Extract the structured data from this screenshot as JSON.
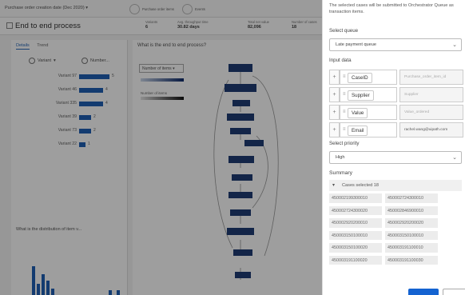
{
  "background": {
    "filter_label": "Purchase order creation date (Dec 2020)",
    "chip1": "Purchase order items",
    "chip2": "Events",
    "page_title": "End to end process",
    "kpis": [
      {
        "label": "Variants",
        "value": "6"
      },
      {
        "label": "Avg. throughput time",
        "value": "30.82 days"
      },
      {
        "label": "Total net value",
        "value": "82,096"
      },
      {
        "label": "Number of cases",
        "value": "18"
      }
    ],
    "tabs": [
      "Details",
      "Trend"
    ],
    "col_variant": "Variant",
    "col_number": "Number...",
    "variants": [
      {
        "name": "Variant 97",
        "value": 5
      },
      {
        "name": "Variant 46",
        "value": 4
      },
      {
        "name": "Variant 335",
        "value": 4
      },
      {
        "name": "Variant 39",
        "value": 2
      },
      {
        "name": "Variant 73",
        "value": 2
      },
      {
        "name": "Variant 22",
        "value": 1
      }
    ],
    "lower_title": "What is the distribution of item v...",
    "main_question": "What is the end to end process?",
    "dropdown": "Number of items",
    "legend_label": "Number of items"
  },
  "panel": {
    "note": "The selected cases will be submitted to Orchestrator Queue as transaction items.",
    "queue_label": "Select queue",
    "queue_value": "Late payment queue",
    "input_label": "Input data",
    "inputs": [
      {
        "key": "CaseID",
        "value": "Purchase_order_item_id",
        "filled": false
      },
      {
        "key": "Supplier",
        "value": "Supplier",
        "filled": false
      },
      {
        "key": "Value",
        "value": "Value_ordered",
        "filled": false
      },
      {
        "key": "Email",
        "value": "rachel.wang@uipath.com",
        "filled": true
      }
    ],
    "priority_label": "Select priority",
    "priority_value": "High",
    "summary_label": "Summary",
    "cases_header": "Cases selected 18",
    "cases": [
      "450002199300010",
      "450002724300010",
      "450002724300020",
      "450002846900010",
      "450002920200010",
      "450002920200020",
      "450003150100010",
      "450003150100010",
      "450003150100020",
      "450003191100010",
      "450003191100020",
      "450003191100030"
    ]
  },
  "colors": {
    "accent": "#1463d1",
    "bar": "#1f5fb5",
    "overlay": "rgba(0,0,0,0.38)"
  }
}
